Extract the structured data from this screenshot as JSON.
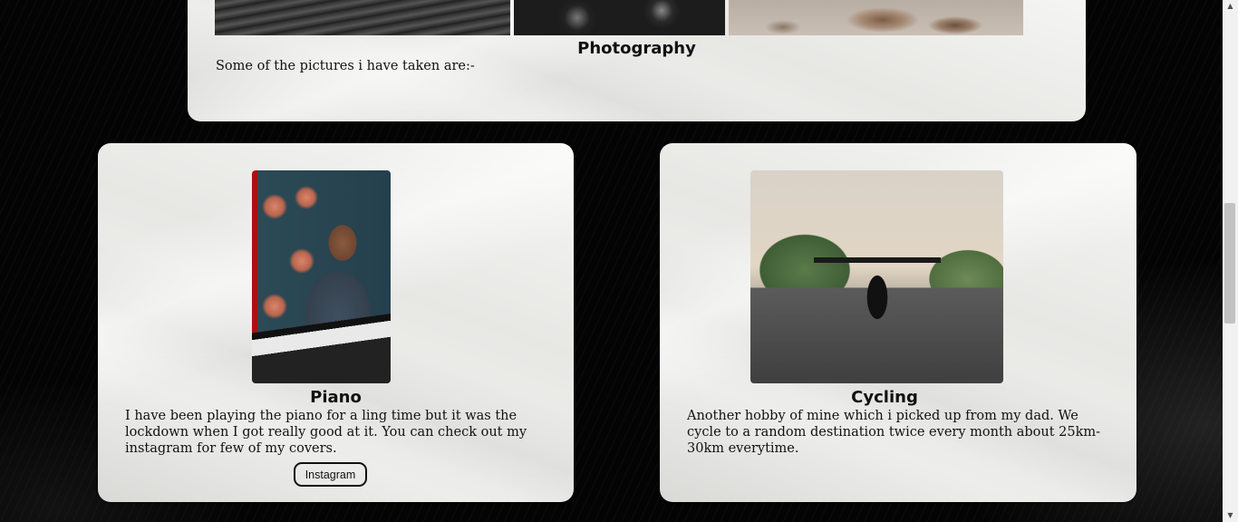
{
  "photography": {
    "title": "Photography",
    "text": "Some of the pictures i have taken are:-"
  },
  "piano": {
    "title": "Piano",
    "text": "I have been playing the piano for a ling time but it was the lockdown when I got really good at it. You can check out my instagram for few of my covers.",
    "button_label": "Instagram"
  },
  "cycling": {
    "title": "Cycling",
    "text": "Another hobby of mine which i picked up from my dad. We cycle to a random destination twice every month about 25km-30km everytime."
  },
  "scrollbar": {
    "up_arrow": "▲",
    "down_arrow": "▼"
  }
}
